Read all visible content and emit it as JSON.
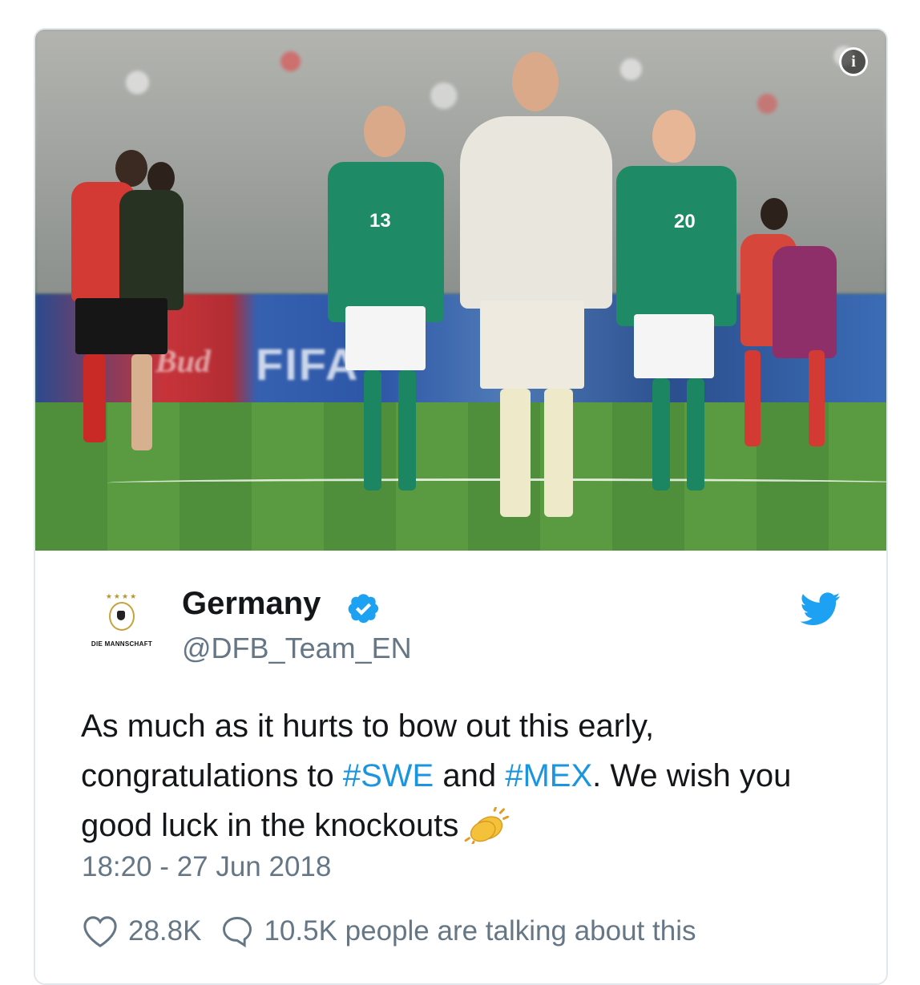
{
  "media": {
    "description_icon": "info-icon",
    "info_label": "i",
    "board_texts": [
      "FIFA",
      "Bud"
    ],
    "jersey_numbers": [
      "13",
      "20"
    ]
  },
  "tweet": {
    "author_name": "Germany",
    "verified": true,
    "handle": "@DFB_Team_EN",
    "avatar_label": "DIE MANNSCHAFT",
    "avatar_stars": "★★★★",
    "text_parts": {
      "p1": "As much as it hurts to bow out this early, congratulations to ",
      "tag1": "#SWE",
      "p2": " and ",
      "tag2": "#MEX",
      "p3": ". We wish you good luck in the knockouts"
    },
    "emoji": "clapping-hands",
    "timestamp": "18:20 - 27 Jun 2018",
    "likes": "28.8K",
    "conversation": "10.5K people are talking about this",
    "brand_icon": "twitter-bird-icon"
  },
  "colors": {
    "twitter_blue": "#1da1f2",
    "hashtag": "#1b95e0",
    "secondary_text": "#657786",
    "border": "#e1e8ed"
  }
}
